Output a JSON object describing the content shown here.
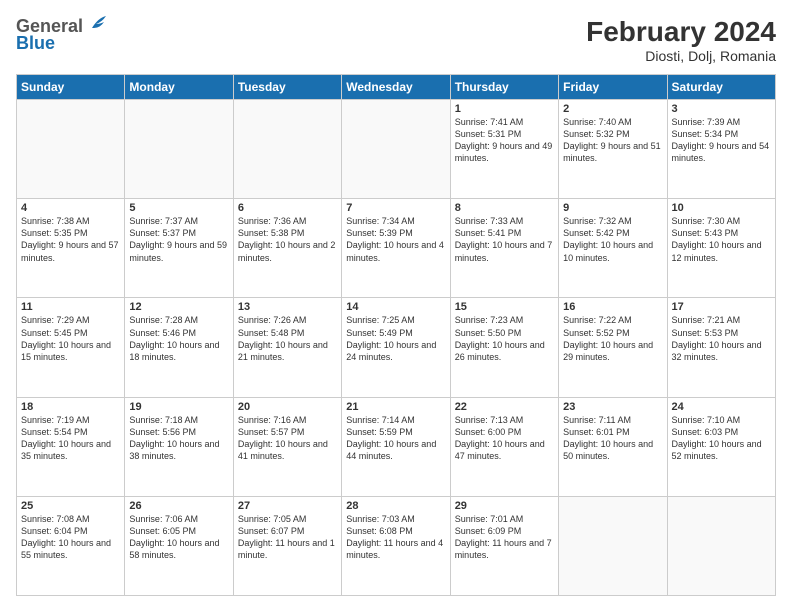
{
  "header": {
    "logo_line1": "General",
    "logo_line2": "Blue",
    "title": "February 2024",
    "subtitle": "Diosti, Dolj, Romania"
  },
  "weekdays": [
    "Sunday",
    "Monday",
    "Tuesday",
    "Wednesday",
    "Thursday",
    "Friday",
    "Saturday"
  ],
  "weeks": [
    [
      {
        "num": "",
        "info": ""
      },
      {
        "num": "",
        "info": ""
      },
      {
        "num": "",
        "info": ""
      },
      {
        "num": "",
        "info": ""
      },
      {
        "num": "1",
        "info": "Sunrise: 7:41 AM\nSunset: 5:31 PM\nDaylight: 9 hours and 49 minutes."
      },
      {
        "num": "2",
        "info": "Sunrise: 7:40 AM\nSunset: 5:32 PM\nDaylight: 9 hours and 51 minutes."
      },
      {
        "num": "3",
        "info": "Sunrise: 7:39 AM\nSunset: 5:34 PM\nDaylight: 9 hours and 54 minutes."
      }
    ],
    [
      {
        "num": "4",
        "info": "Sunrise: 7:38 AM\nSunset: 5:35 PM\nDaylight: 9 hours and 57 minutes."
      },
      {
        "num": "5",
        "info": "Sunrise: 7:37 AM\nSunset: 5:37 PM\nDaylight: 9 hours and 59 minutes."
      },
      {
        "num": "6",
        "info": "Sunrise: 7:36 AM\nSunset: 5:38 PM\nDaylight: 10 hours and 2 minutes."
      },
      {
        "num": "7",
        "info": "Sunrise: 7:34 AM\nSunset: 5:39 PM\nDaylight: 10 hours and 4 minutes."
      },
      {
        "num": "8",
        "info": "Sunrise: 7:33 AM\nSunset: 5:41 PM\nDaylight: 10 hours and 7 minutes."
      },
      {
        "num": "9",
        "info": "Sunrise: 7:32 AM\nSunset: 5:42 PM\nDaylight: 10 hours and 10 minutes."
      },
      {
        "num": "10",
        "info": "Sunrise: 7:30 AM\nSunset: 5:43 PM\nDaylight: 10 hours and 12 minutes."
      }
    ],
    [
      {
        "num": "11",
        "info": "Sunrise: 7:29 AM\nSunset: 5:45 PM\nDaylight: 10 hours and 15 minutes."
      },
      {
        "num": "12",
        "info": "Sunrise: 7:28 AM\nSunset: 5:46 PM\nDaylight: 10 hours and 18 minutes."
      },
      {
        "num": "13",
        "info": "Sunrise: 7:26 AM\nSunset: 5:48 PM\nDaylight: 10 hours and 21 minutes."
      },
      {
        "num": "14",
        "info": "Sunrise: 7:25 AM\nSunset: 5:49 PM\nDaylight: 10 hours and 24 minutes."
      },
      {
        "num": "15",
        "info": "Sunrise: 7:23 AM\nSunset: 5:50 PM\nDaylight: 10 hours and 26 minutes."
      },
      {
        "num": "16",
        "info": "Sunrise: 7:22 AM\nSunset: 5:52 PM\nDaylight: 10 hours and 29 minutes."
      },
      {
        "num": "17",
        "info": "Sunrise: 7:21 AM\nSunset: 5:53 PM\nDaylight: 10 hours and 32 minutes."
      }
    ],
    [
      {
        "num": "18",
        "info": "Sunrise: 7:19 AM\nSunset: 5:54 PM\nDaylight: 10 hours and 35 minutes."
      },
      {
        "num": "19",
        "info": "Sunrise: 7:18 AM\nSunset: 5:56 PM\nDaylight: 10 hours and 38 minutes."
      },
      {
        "num": "20",
        "info": "Sunrise: 7:16 AM\nSunset: 5:57 PM\nDaylight: 10 hours and 41 minutes."
      },
      {
        "num": "21",
        "info": "Sunrise: 7:14 AM\nSunset: 5:59 PM\nDaylight: 10 hours and 44 minutes."
      },
      {
        "num": "22",
        "info": "Sunrise: 7:13 AM\nSunset: 6:00 PM\nDaylight: 10 hours and 47 minutes."
      },
      {
        "num": "23",
        "info": "Sunrise: 7:11 AM\nSunset: 6:01 PM\nDaylight: 10 hours and 50 minutes."
      },
      {
        "num": "24",
        "info": "Sunrise: 7:10 AM\nSunset: 6:03 PM\nDaylight: 10 hours and 52 minutes."
      }
    ],
    [
      {
        "num": "25",
        "info": "Sunrise: 7:08 AM\nSunset: 6:04 PM\nDaylight: 10 hours and 55 minutes."
      },
      {
        "num": "26",
        "info": "Sunrise: 7:06 AM\nSunset: 6:05 PM\nDaylight: 10 hours and 58 minutes."
      },
      {
        "num": "27",
        "info": "Sunrise: 7:05 AM\nSunset: 6:07 PM\nDaylight: 11 hours and 1 minute."
      },
      {
        "num": "28",
        "info": "Sunrise: 7:03 AM\nSunset: 6:08 PM\nDaylight: 11 hours and 4 minutes."
      },
      {
        "num": "29",
        "info": "Sunrise: 7:01 AM\nSunset: 6:09 PM\nDaylight: 11 hours and 7 minutes."
      },
      {
        "num": "",
        "info": ""
      },
      {
        "num": "",
        "info": ""
      }
    ]
  ]
}
